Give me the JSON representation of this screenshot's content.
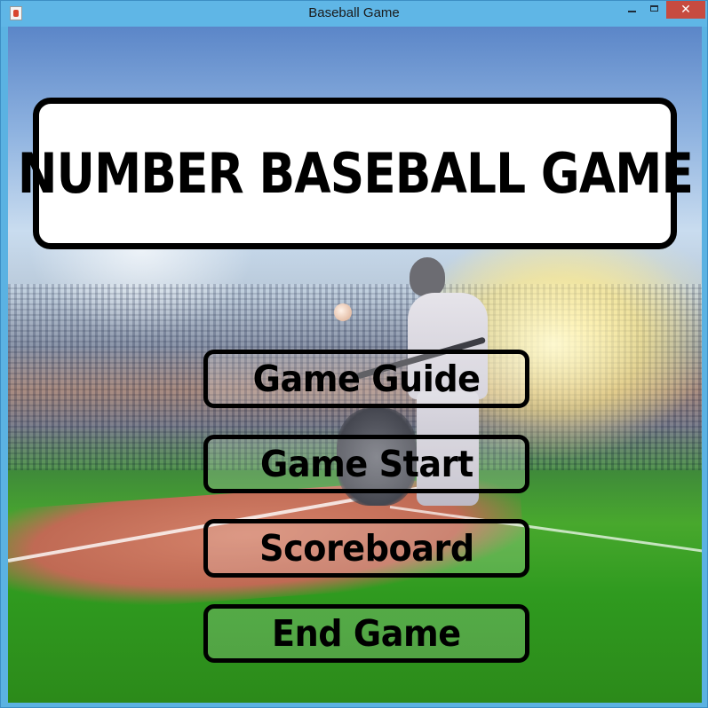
{
  "window": {
    "title": "Baseball Game",
    "controls": {
      "minimize_icon": "minimize-icon",
      "maximize_icon": "maximize-icon",
      "close_label": "✕"
    }
  },
  "main": {
    "heading": "NUMBER BASEBALL GAME",
    "buttons": [
      {
        "label": "Game Guide"
      },
      {
        "label": "Game Start"
      },
      {
        "label": "Scoreboard"
      },
      {
        "label": "End Game"
      }
    ]
  },
  "colors": {
    "titlebar": "#5fb6e6",
    "close_button": "#c74b40",
    "button_border": "#000000",
    "heading_panel": "#ffffff"
  }
}
